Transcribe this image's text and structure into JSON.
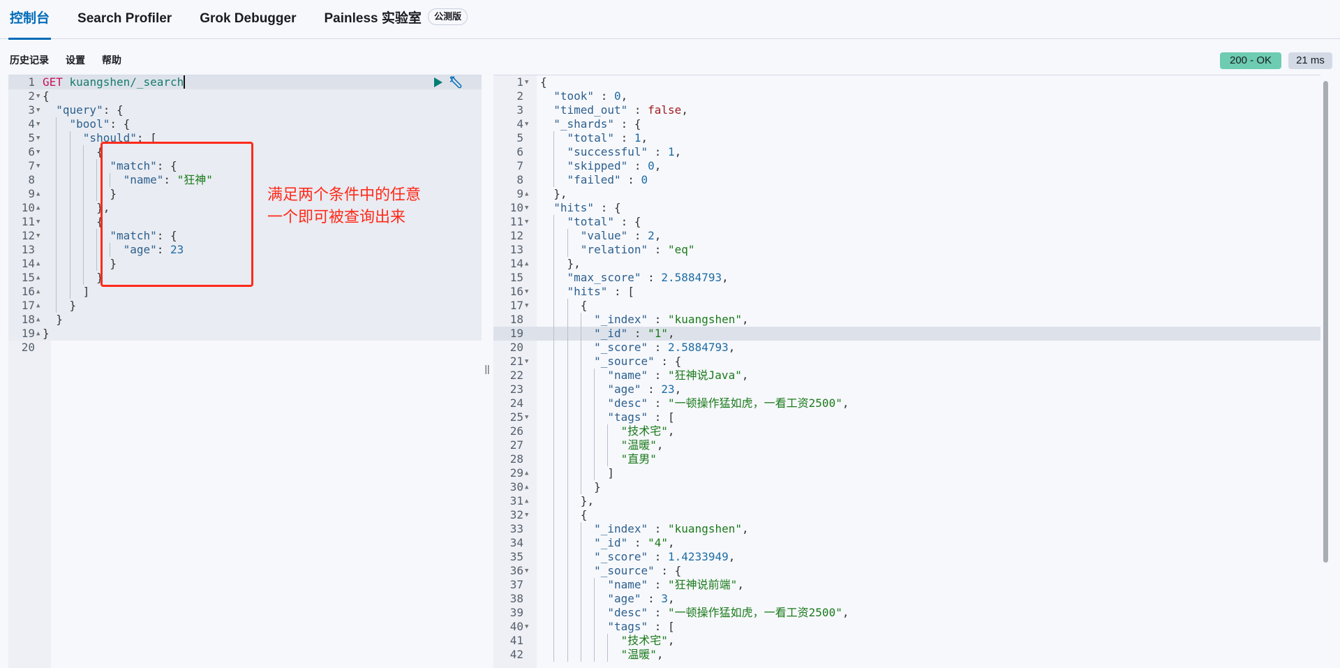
{
  "tabs": [
    {
      "label": "控制台",
      "active": true
    },
    {
      "label": "Search Profiler"
    },
    {
      "label": "Grok Debugger"
    },
    {
      "label": "Painless 实验室",
      "badge": "公测版"
    }
  ],
  "toolbar": {
    "history": "历史记录",
    "settings": "设置",
    "help": "帮助"
  },
  "status": {
    "code": "200 - OK",
    "time": "21 ms",
    "ok_color": "#6dccb1"
  },
  "annotation": {
    "line1": "满足两个条件中的任意",
    "line2": "一个即可被查询出来",
    "color": "#ff2a1a"
  },
  "request": {
    "method": "GET",
    "path": "kuangshen/_search",
    "lines": [
      "GET kuangshen/_search",
      "{",
      "  \"query\": {",
      "    \"bool\": {",
      "      \"should\": [",
      "        {",
      "          \"match\": {",
      "            \"name\": \"狂神\"",
      "          }",
      "        },",
      "        {",
      "          \"match\": {",
      "            \"age\": 23",
      "          }",
      "        }",
      "      ]",
      "    }",
      "  }",
      "}",
      ""
    ]
  },
  "response": {
    "active_line": 19,
    "lines": [
      "{",
      "  \"took\" : 0,",
      "  \"timed_out\" : false,",
      "  \"_shards\" : {",
      "    \"total\" : 1,",
      "    \"successful\" : 1,",
      "    \"skipped\" : 0,",
      "    \"failed\" : 0",
      "  },",
      "  \"hits\" : {",
      "    \"total\" : {",
      "      \"value\" : 2,",
      "      \"relation\" : \"eq\"",
      "    },",
      "    \"max_score\" : 2.5884793,",
      "    \"hits\" : [",
      "      {",
      "        \"_index\" : \"kuangshen\",",
      "        \"_id\" : \"1\",",
      "        \"_score\" : 2.5884793,",
      "        \"_source\" : {",
      "          \"name\" : \"狂神说Java\",",
      "          \"age\" : 23,",
      "          \"desc\" : \"一顿操作猛如虎，一看工资2500\",",
      "          \"tags\" : [",
      "            \"技术宅\",",
      "            \"温暖\",",
      "            \"直男\"",
      "          ]",
      "        }",
      "      },",
      "      {",
      "        \"_index\" : \"kuangshen\",",
      "        \"_id\" : \"4\",",
      "        \"_score\" : 1.4233949,",
      "        \"_source\" : {",
      "          \"name\" : \"狂神说前端\",",
      "          \"age\" : 3,",
      "          \"desc\" : \"一顿操作猛如虎，一看工资2500\",",
      "          \"tags\" : [",
      "            \"技术宅\",",
      "            \"温暖\","
    ]
  }
}
